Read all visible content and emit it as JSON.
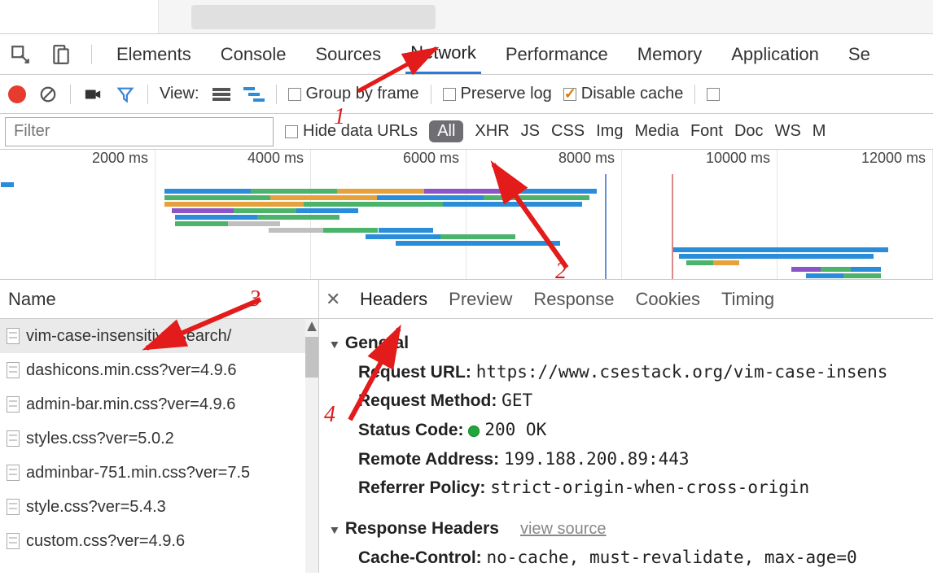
{
  "tabs": {
    "elements": "Elements",
    "console": "Console",
    "sources": "Sources",
    "network": "Network",
    "performance": "Performance",
    "memory": "Memory",
    "application": "Application",
    "security_partial": "Se"
  },
  "toolbar": {
    "view_label": "View:",
    "group_by_frame": "Group by frame",
    "preserve_log": "Preserve log",
    "disable_cache": "Disable cache"
  },
  "filterbar": {
    "filter_placeholder": "Filter",
    "hide_data_urls": "Hide data URLs",
    "all": "All",
    "xhr": "XHR",
    "js": "JS",
    "css": "CSS",
    "img": "Img",
    "media": "Media",
    "font": "Font",
    "doc": "Doc",
    "ws": "WS",
    "manifest_partial": "M"
  },
  "timeline": {
    "ticks": [
      "2000 ms",
      "4000 ms",
      "6000 ms",
      "8000 ms",
      "10000 ms",
      "12000 ms"
    ]
  },
  "name_header": "Name",
  "requests": [
    {
      "name": "vim-case-insensitive-search/",
      "selected": true
    },
    {
      "name": "dashicons.min.css?ver=4.9.6",
      "selected": false
    },
    {
      "name": "admin-bar.min.css?ver=4.9.6",
      "selected": false
    },
    {
      "name": "styles.css?ver=5.0.2",
      "selected": false
    },
    {
      "name": "adminbar-751.min.css?ver=7.5",
      "selected": false
    },
    {
      "name": "style.css?ver=5.4.3",
      "selected": false
    },
    {
      "name": "custom.css?ver=4.9.6",
      "selected": false
    }
  ],
  "detail_tabs": {
    "headers": "Headers",
    "preview": "Preview",
    "response": "Response",
    "cookies": "Cookies",
    "timing": "Timing"
  },
  "general": {
    "section": "General",
    "request_url_label": "Request URL:",
    "request_url_value": "https://www.csestack.org/vim-case-insens",
    "request_method_label": "Request Method:",
    "request_method_value": "GET",
    "status_code_label": "Status Code:",
    "status_code_value": "200 OK",
    "remote_address_label": "Remote Address:",
    "remote_address_value": "199.188.200.89:443",
    "referrer_policy_label": "Referrer Policy:",
    "referrer_policy_value": "strict-origin-when-cross-origin"
  },
  "response_headers": {
    "section": "Response Headers",
    "view_source": "view source",
    "cache_control_label": "Cache-Control:",
    "cache_control_value": "no-cache, must-revalidate, max-age=0"
  },
  "annotations": {
    "n1": "1",
    "n2": "2",
    "n3": "3",
    "n4": "4"
  },
  "chart_data": {
    "type": "timeline",
    "x_unit": "ms",
    "ticks": [
      2000,
      4000,
      6000,
      8000,
      10000,
      12000
    ],
    "xlim": [
      0,
      12500
    ],
    "markers": [
      {
        "kind": "domcontentloaded",
        "at": 8100,
        "color": "#6390d6"
      },
      {
        "kind": "load",
        "at": 9000,
        "color": "#d88"
      }
    ],
    "tracks": [
      {
        "start": 10,
        "duration": 180,
        "colors": [
          "#2a8dd9"
        ]
      },
      {
        "start": 2200,
        "duration": 5800,
        "colors": [
          "#2a8dd9",
          "#4bb36a",
          "#e6a13a",
          "#8b55c7",
          "#2a8dd9"
        ]
      },
      {
        "start": 2200,
        "duration": 5700,
        "colors": [
          "#4bb36a",
          "#e6a13a",
          "#2a8dd9",
          "#4bb36a"
        ]
      },
      {
        "start": 2200,
        "duration": 5600,
        "colors": [
          "#e6a13a",
          "#4bb36a",
          "#2a8dd9"
        ]
      },
      {
        "start": 2300,
        "duration": 2500,
        "colors": [
          "#8b55c7",
          "#4bb36a",
          "#2a8dd9"
        ]
      },
      {
        "start": 2350,
        "duration": 2200,
        "colors": [
          "#2a8dd9",
          "#4bb36a"
        ]
      },
      {
        "start": 2350,
        "duration": 1400,
        "colors": [
          "#4bb36a",
          "#bfbfbf"
        ]
      },
      {
        "start": 3600,
        "duration": 2200,
        "colors": [
          "#bfbfbf",
          "#4bb36a",
          "#2a8dd9"
        ]
      },
      {
        "start": 4900,
        "duration": 2000,
        "colors": [
          "#2a8dd9",
          "#4bb36a"
        ]
      },
      {
        "start": 5300,
        "duration": 2200,
        "colors": [
          "#2a8dd9"
        ]
      },
      {
        "start": 9000,
        "duration": 2900,
        "colors": [
          "#2a8dd9"
        ]
      },
      {
        "start": 9100,
        "duration": 2600,
        "colors": [
          "#2a8dd9"
        ]
      },
      {
        "start": 9200,
        "duration": 700,
        "colors": [
          "#4bb36a",
          "#e6a13a"
        ]
      },
      {
        "start": 10600,
        "duration": 1200,
        "colors": [
          "#8b55c7",
          "#4bb36a",
          "#2a8dd9"
        ]
      },
      {
        "start": 10800,
        "duration": 1000,
        "colors": [
          "#2a8dd9",
          "#4bb36a"
        ]
      }
    ]
  }
}
